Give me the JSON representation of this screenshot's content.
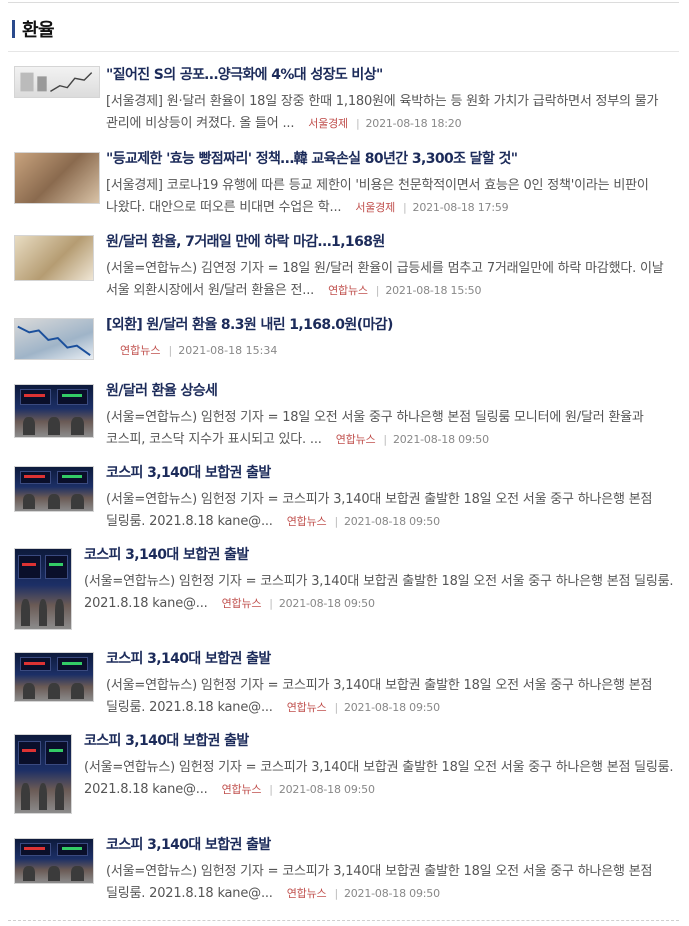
{
  "section": {
    "title": "환율"
  },
  "articles": [
    {
      "title": "\"짙어진 S의 공포…양극화에 4%대 성장도 비상\"",
      "snippet": "[서울경제] 원·달러 환율이 18일 장중 한때 1,180원에 육박하는 등 원화 가치가 급락하면서 정부의 물가 관리에 비상등이 켜졌다. 올 들어 ...",
      "source": "서울경제",
      "date": "2021-08-18 18:20",
      "thumb": "chart"
    },
    {
      "title": "\"등교제한 '효능 빵점짜리' 정책…韓 교육손실 80년간 3,300조 달할 것\"",
      "snippet": "[서울경제] 코로나19 유행에 따른 등교 제한이 '비용은 천문학적이면서 효능은 0인 정책'이라는 비판이 나왔다. 대안으로 떠오른 비대면 수업은 학...",
      "source": "서울경제",
      "date": "2021-08-18 17:59",
      "thumb": "kids"
    },
    {
      "title": "원/달러 환율, 7거래일 만에 하락 마감…1,168원",
      "snippet": "(서울=연합뉴스) 김연정 기자 = 18일 원/달러 환율이 급등세를 멈추고 7거래일만에 하락 마감했다. 이날 서울 외환시장에서 원/달러 환율은 전...",
      "source": "연합뉴스",
      "date": "2021-08-18 15:50",
      "thumb": "money"
    },
    {
      "title": "[외환] 원/달러 환율 8.3원 내린 1,168.0원(마감)",
      "snippet": "",
      "source": "연합뉴스",
      "date": "2021-08-18 15:34",
      "thumb": "money2"
    },
    {
      "title": "원/달러 환율 상승세",
      "snippet": "(서울=연합뉴스) 임헌정 기자 = 18일 오전 서울 중구 하나은행 본점 딜링룸 모니터에 원/달러 환율과 코스피, 코스닥 지수가 표시되고 있다. ...",
      "source": "연합뉴스",
      "date": "2021-08-18 09:50",
      "thumb": "monitor"
    },
    {
      "title": "코스피 3,140대 보합권 출발",
      "snippet": "(서울=연합뉴스) 임헌정 기자 = 코스피가 3,140대 보합권 출발한 18일 오전 서울 중구 하나은행 본점 딜링룸. 2021.8.18 kane@...",
      "source": "연합뉴스",
      "date": "2021-08-18 09:50",
      "thumb": "monitor"
    },
    {
      "title": "코스피 3,140대 보합권 출발",
      "snippet": "(서울=연합뉴스) 임헌정 기자 = 코스피가 3,140대 보합권 출발한 18일 오전 서울 중구 하나은행 본점 딜링룸. 2021.8.18 kane@...",
      "source": "연합뉴스",
      "date": "2021-08-18 09:50",
      "thumb": "monitor"
    },
    {
      "title": "코스피 3,140대 보합권 출발",
      "snippet": "(서울=연합뉴스) 임헌정 기자 = 코스피가 3,140대 보합권 출발한 18일 오전 서울 중구 하나은행 본점 딜링룸. 2021.8.18 kane@...",
      "source": "연합뉴스",
      "date": "2021-08-18 09:50",
      "thumb": "monitor"
    },
    {
      "title": "코스피 3,140대 보합권 출발",
      "snippet": "(서울=연합뉴스) 임헌정 기자 = 코스피가 3,140대 보합권 출발한 18일 오전 서울 중구 하나은행 본점 딜링룸. 2021.8.18 kane@...",
      "source": "연합뉴스",
      "date": "2021-08-18 09:50",
      "thumb": "monitor"
    },
    {
      "title": "코스피 3,140대 보합권 출발",
      "snippet": "(서울=연합뉴스) 임헌정 기자 = 코스피가 3,140대 보합권 출발한 18일 오전 서울 중구 하나은행 본점 딜링룸. 2021.8.18 kane@...",
      "source": "연합뉴스",
      "date": "2021-08-18 09:50",
      "thumb": "monitor"
    }
  ]
}
